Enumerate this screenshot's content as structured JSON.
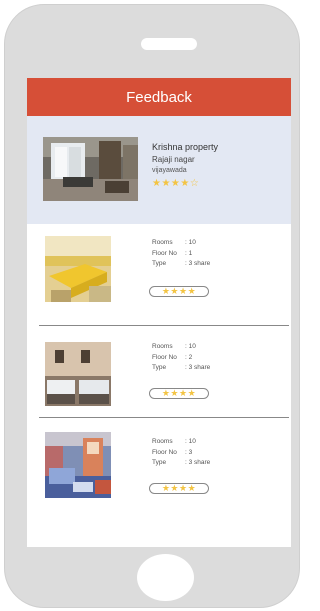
{
  "header": {
    "title": "Feedback"
  },
  "property": {
    "name": "Krishna property",
    "area": "Rajaji nagar",
    "city": "vijayawada",
    "stars": "★★★★☆"
  },
  "labels": {
    "rooms": "Rooms",
    "floor": "Floor No",
    "type": "Type"
  },
  "rooms": [
    {
      "rooms": ": 10",
      "floor": ": 1",
      "type": ": 3 share",
      "rating": "★★★★"
    },
    {
      "rooms": ": 10",
      "floor": ": 2",
      "type": ": 3 share",
      "rating": "★★★★"
    },
    {
      "rooms": ": 10",
      "floor": ": 3",
      "type": ": 3 share",
      "rating": "★★★★"
    }
  ],
  "colors": {
    "header": "#d64f37",
    "highlight": "#e3e8f3",
    "star": "#f3c443"
  }
}
